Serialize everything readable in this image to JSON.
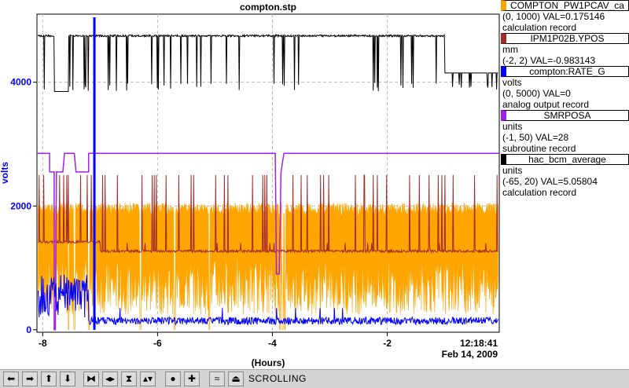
{
  "chart_data": {
    "type": "line",
    "title": "compton.stp",
    "xlabel": "(Hours)",
    "ylabel": "volts",
    "xlim": [
      -8.1,
      -0.05
    ],
    "ylim": [
      -40,
      5100
    ],
    "x_ticks": [
      "-8",
      "-6",
      "-4",
      "-2"
    ],
    "x_tick_values": [
      -8,
      -6,
      -4,
      -2
    ],
    "y_ticks": [
      "0",
      "2000",
      "4000"
    ],
    "y_tick_values": [
      0,
      2000,
      4000
    ],
    "grid": true,
    "time_label": "12:18:41",
    "date_label": "Feb 14, 2009",
    "series": [
      {
        "name": "COMPTON_PW1PCAV_ca",
        "color": "#ffa500",
        "base": 1900,
        "upper": 2050,
        "lower": 250
      },
      {
        "name": "IPM1P02B.YPOS",
        "color": "#a52a2a",
        "base": 1270,
        "spike_top": 2500
      },
      {
        "name": "compton:RATE_G",
        "color": "#0000ff",
        "base": 120,
        "spike_x": -7.1,
        "spike_top": 5050
      },
      {
        "name": "SMRPOSA",
        "color": "#a020f0",
        "base": 2850,
        "drop_low": 900
      },
      {
        "name": "hac_bcm_average",
        "color": "#000000",
        "high": 4750,
        "low": 3850
      }
    ]
  },
  "legend": [
    {
      "name": "COMPTON_PW1PCAV_ca",
      "color": "#ffa500",
      "unit": "",
      "range_val": "(0, 1000) VAL=0.175146",
      "record": "calculation record"
    },
    {
      "name": "IPM1P02B.YPOS",
      "color": "#a52a2a",
      "unit": "mm",
      "range_val": "(-2, 2) VAL=-0.983143",
      "record": ""
    },
    {
      "name": "compton:RATE_G",
      "color": "#0000ff",
      "unit": "volts",
      "range_val": "(0, 5000) VAL=0",
      "record": "analog output record"
    },
    {
      "name": "SMRPOSA",
      "color": "#a020f0",
      "unit": "units",
      "range_val": "(-1, 50) VAL=28",
      "record": "subroutine record"
    },
    {
      "name": "hac_bcm_average",
      "color": "#000000",
      "unit": "units",
      "range_val": "(-65, 20) VAL=5.05804",
      "record": "calculation record"
    }
  ],
  "toolbar": {
    "buttons": [
      "arrow-left-icon",
      "arrow-right-icon",
      "arrow-up-icon",
      "arrow-down-icon",
      "zoom-in-x-icon",
      "zoom-out-x-icon",
      "zoom-in-y-icon",
      "zoom-out-y-icon",
      "autoscale-icon",
      "plus-icon",
      "waveform-icon",
      "print-icon"
    ],
    "glyphs": [
      "⬅",
      "➡",
      "⬆",
      "⬇",
      "⧓",
      "◂▸",
      "⧗",
      "▴▾",
      "●",
      "✚",
      "≈",
      "⏏"
    ],
    "status": "SCROLLING"
  }
}
